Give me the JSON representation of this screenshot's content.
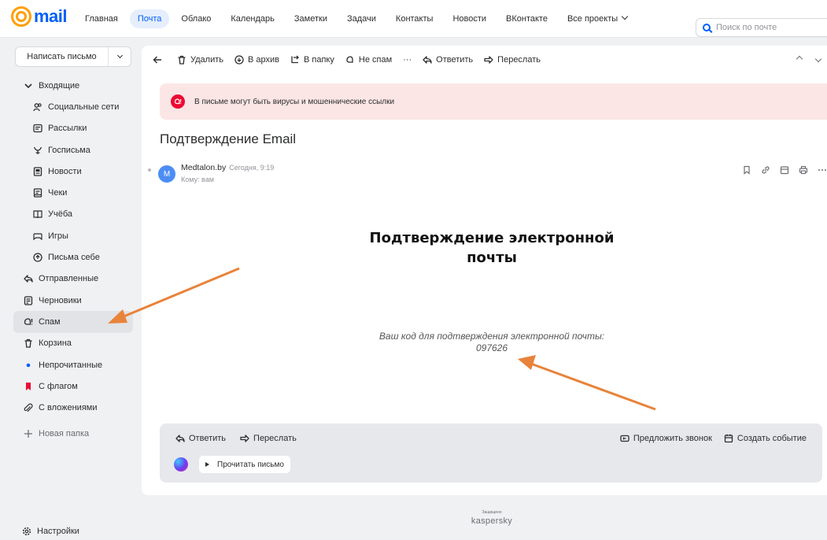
{
  "brand": {
    "logo_text": "mail"
  },
  "topnav": {
    "items": [
      "Главная",
      "Почта",
      "Облако",
      "Календарь",
      "Заметки",
      "Задачи",
      "Контакты",
      "Новости",
      "ВКонтакте",
      "Все проекты"
    ],
    "active_index": 1,
    "search_placeholder": "Поиск по почте"
  },
  "sidebar": {
    "compose_label": "Написать письмо",
    "folders": [
      {
        "label": "Входящие",
        "icon": "chevron-down-icon",
        "sub": false
      },
      {
        "label": "Социальные сети",
        "icon": "social-icon",
        "sub": true
      },
      {
        "label": "Рассылки",
        "icon": "newsletter-icon",
        "sub": true
      },
      {
        "label": "Госписьма",
        "icon": "emblem-icon",
        "sub": true
      },
      {
        "label": "Новости",
        "icon": "news-icon",
        "sub": true
      },
      {
        "label": "Чеки",
        "icon": "receipt-icon",
        "sub": true
      },
      {
        "label": "Учёба",
        "icon": "book-icon",
        "sub": true
      },
      {
        "label": "Игры",
        "icon": "gamepad-icon",
        "sub": true
      },
      {
        "label": "Письма себе",
        "icon": "self-mail-icon",
        "sub": true
      },
      {
        "label": "Отправленные",
        "icon": "sent-icon",
        "sub": false
      },
      {
        "label": "Черновики",
        "icon": "draft-icon",
        "sub": false
      },
      {
        "label": "Спам",
        "icon": "spam-icon",
        "sub": false,
        "active": true
      },
      {
        "label": "Корзина",
        "icon": "trash-icon",
        "sub": false
      },
      {
        "label": "Непрочитанные",
        "icon": "unread-dot-icon",
        "sub": false
      },
      {
        "label": "С флагом",
        "icon": "flag-icon",
        "sub": false
      },
      {
        "label": "С вложениями",
        "icon": "paperclip-icon",
        "sub": false
      },
      {
        "label": "Новая папка",
        "icon": "plus-icon",
        "sub": false
      }
    ],
    "settings_label": "Настройки"
  },
  "toolbar": {
    "delete": "Удалить",
    "archive": "В архив",
    "to_folder": "В папку",
    "not_spam": "Не спам",
    "more": "···",
    "reply": "Ответить",
    "forward": "Переслать"
  },
  "alert": {
    "text": "В письме могут быть вирусы и мошеннические ссылки"
  },
  "message": {
    "subject": "Подтверждение Email",
    "avatar_letter": "M",
    "sender": "Medtalon.by",
    "time": "Сегодня, 9:19",
    "to": "Кому: вам",
    "title_line1": "Подтверждение электронной",
    "title_line2": "почты",
    "body_line1": "Ваш код для подтверждения электронной почты:",
    "code": "097626"
  },
  "bottom_bar": {
    "reply": "Ответить",
    "forward": "Переслать",
    "suggest_call": "Предложить звонок",
    "create_event": "Создать событие",
    "read_aloud": "Прочитать письмо"
  },
  "footer": {
    "protected": "Защищено",
    "vendor": "kaspersky"
  },
  "colors": {
    "brand": "#005ff9",
    "logo_accent": "#ff9e00",
    "alert_bg": "#fbe6e5",
    "alert_icon": "#ed0a34",
    "arrow": "#e8833a",
    "flag": "#ed0a34",
    "unread": "#005ff9"
  }
}
